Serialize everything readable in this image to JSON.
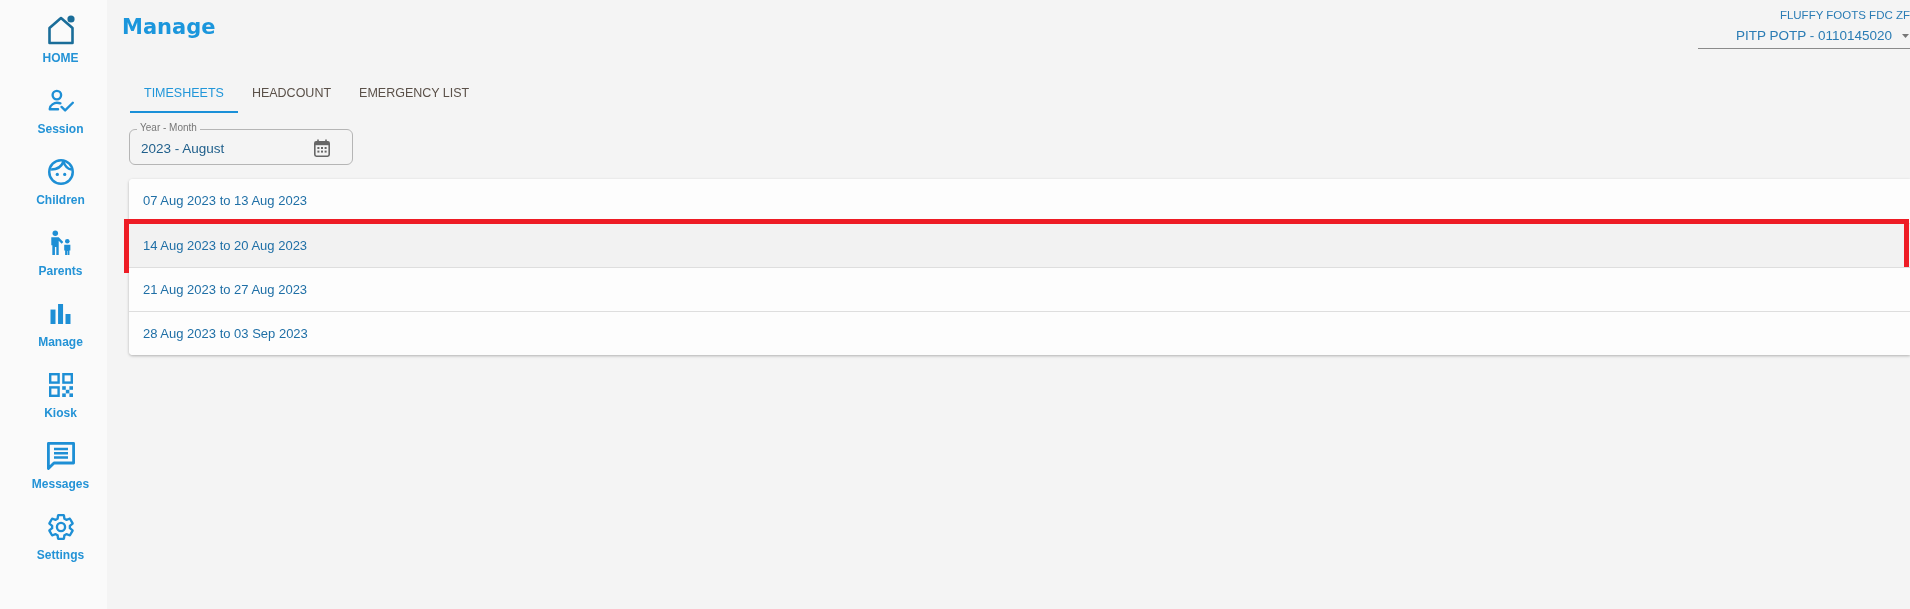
{
  "sidebar": {
    "items": [
      {
        "label": "HOME"
      },
      {
        "label": "Session"
      },
      {
        "label": "Children"
      },
      {
        "label": "Parents"
      },
      {
        "label": "Manage"
      },
      {
        "label": "Kiosk"
      },
      {
        "label": "Messages"
      },
      {
        "label": "Settings"
      }
    ]
  },
  "header": {
    "title": "Manage",
    "organization": "FLUFFY FOOTS FDC ZF",
    "account": "PITP POTP - 0110145020"
  },
  "tabs": [
    {
      "label": "TIMESHEETS",
      "selected": true
    },
    {
      "label": "HEADCOUNT",
      "selected": false
    },
    {
      "label": "EMERGENCY LIST",
      "selected": false
    }
  ],
  "month_field": {
    "label": "Year - Month",
    "value": "2023 - August"
  },
  "weeks": [
    {
      "label": "07 Aug 2023 to 13 Aug 2023",
      "selected": false,
      "marked": false
    },
    {
      "label": "14 Aug 2023 to 20 Aug 2023",
      "selected": true,
      "marked": true
    },
    {
      "label": "21 Aug 2023 to 27 Aug 2023",
      "selected": false,
      "marked": false
    },
    {
      "label": "28 Aug 2023 to 03 Sep 2023",
      "selected": false,
      "marked": false
    }
  ]
}
